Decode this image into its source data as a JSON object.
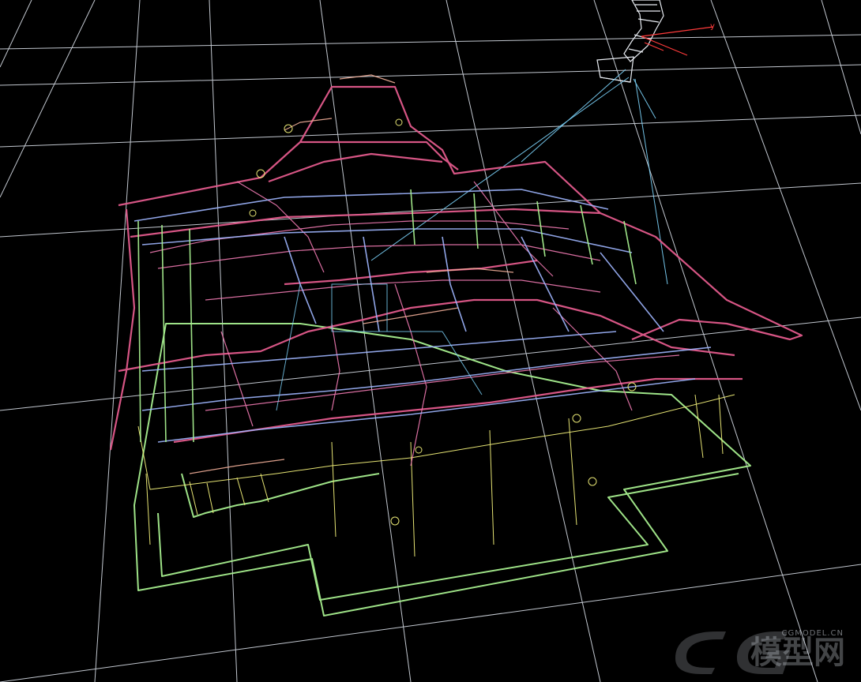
{
  "viewport": {
    "view_type": "perspective-wireframe",
    "background_color": "#000000",
    "grid_color": "#d7dde6",
    "palette": {
      "rose": "#e25a8c",
      "pink": "#f07ab2",
      "lavender": "#9fb6ff",
      "peach": "#f4b09a",
      "yellow": "#f2f07a",
      "green": "#a7ef8f",
      "cyan": "#7fd7ff",
      "red_axis": "#ff3b3b"
    }
  },
  "watermark": {
    "logo_letters": "CG",
    "site_url": "CGMODEL.CN",
    "site_name_cn": "模型网"
  },
  "icons": [
    "camera-icon",
    "grid-icon"
  ]
}
